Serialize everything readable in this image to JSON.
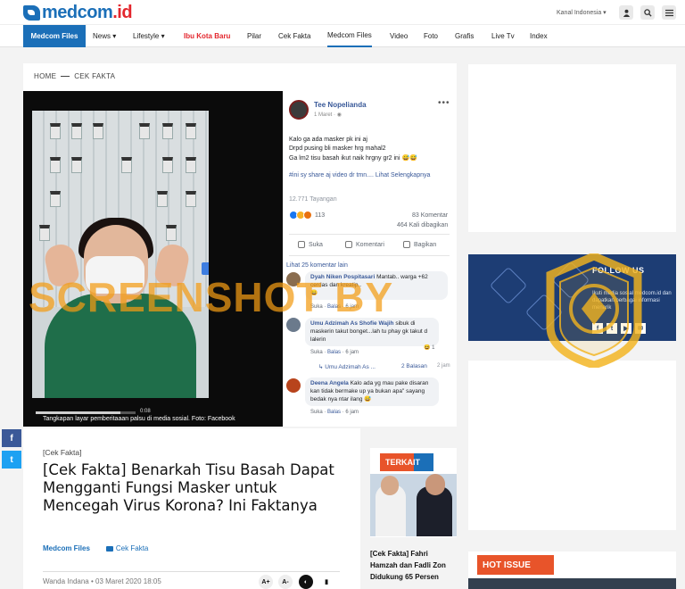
{
  "brand": {
    "logo_text": "medcom",
    "logo_suffix": ".id"
  },
  "topbar": {
    "kanal": "Kanal Indonesia ▾",
    "icons": [
      "user-icon",
      "search-icon",
      "menu-icon"
    ]
  },
  "nav": {
    "first": "Medcom Files",
    "items": [
      "News ▾",
      "Lifestyle ▾",
      "Ibu Kota Baru",
      "Pilar",
      "Cek Fakta",
      "Medcom Files",
      "Video",
      "Foto",
      "Grafis",
      "Live Tv",
      "Index"
    ]
  },
  "breadcrumb": {
    "home": "HOME",
    "section": "CEK FAKTA"
  },
  "video": {
    "caption": "Tangkapan layar pemberitaaan palsu di media sosial. Foto: Facebook",
    "time": "0:08"
  },
  "fb_post": {
    "name": "Tee Nopelianda",
    "date": "1 Maret · ",
    "text_lines": [
      "Kalo ga ada masker pk ini aj",
      "Drpd pusing bli masker hrg mahal2",
      "Ga lm2 tisu basah ikut naik hrgny gr2 ini 😅😅"
    ],
    "hashtag": "#ini sy share aj video dr tmn.... Lihat Selengkapnya",
    "views": "12.771 Tayangan",
    "reaction_count": "113",
    "comments_count": "83 Komentar",
    "shares_count": "464 Kali dibagikan",
    "actions": [
      "Suka",
      "Komentari",
      "Bagikan"
    ],
    "more_comments": "Lihat 25 komentar lain",
    "comments": [
      {
        "name": "Dyah Niken Pospitasari",
        "text": "Mantab.. warga +62 cerdas dan kreatip..",
        "extra": "😄",
        "meta_prefix": "Suka · ",
        "meta_link": "Balas",
        "meta_time": " · 6 jam"
      },
      {
        "name": "Umu Adzimah As Shofie Wajih",
        "text": "sibuk di maskerin takut bonget...lah tu phay gk takut d lalerin",
        "extra": "😆 1",
        "meta_prefix": "Suka · ",
        "meta_link": "Balas",
        "meta_time": " · 6 jam"
      },
      {
        "name": "Deena Angela",
        "text": "Kalo ada yg mau pake disaran kan tidak bermake up ya bukan apa\" sayang bedak nya ntar ilang 😅",
        "extra": "",
        "meta_prefix": "Suka · ",
        "meta_link": "Balas",
        "meta_time": " · 6 jam"
      }
    ],
    "reply": {
      "name": "Umu Adzimah As ...",
      "count": "2 Balasan",
      "time": "2 jam"
    }
  },
  "share": {
    "facebook": "f",
    "twitter": "t"
  },
  "article": {
    "kicker": "[Cek Fakta]",
    "title": "[Cek Fakta] Benarkah Tisu Basah Dapat Mengganti Fungsi Masker untuk Mencegah Virus Korona? Ini Faktanya",
    "channel": "Medcom Files",
    "tag": "Cek Fakta",
    "author_date": "Wanda Indana • 03 Maret 2020 18:05",
    "tools": [
      "A+",
      "A-",
      "◐",
      "▮"
    ]
  },
  "terkait": {
    "label": "TERKAIT",
    "caption": "[Cek Fakta] Fahri Hamzah dan Fadli Zon Didukung 65 Persen"
  },
  "follow_banner": {
    "title": "FOLLOW US",
    "text": "Ikuti media sosial medcom.id dan dapatkan berbagai informasi menarik",
    "icons": [
      "f",
      "t",
      "▶",
      "✉"
    ]
  },
  "hot_issue": {
    "label": "HOT ISSUE"
  },
  "watermark": {
    "text": "SCREENSHOT BY"
  },
  "colors": {
    "brand_blue": "#1b6fb8",
    "accent_orange": "#e8542a",
    "brand_red": "#e3262d"
  }
}
